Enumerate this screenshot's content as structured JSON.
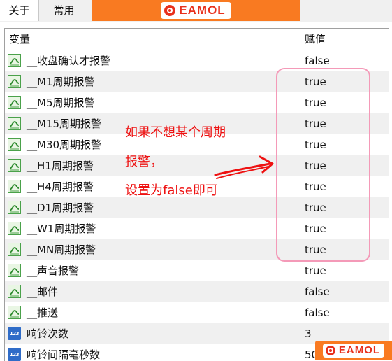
{
  "tabs": [
    {
      "label": "关于"
    },
    {
      "label": "常用"
    }
  ],
  "brand": {
    "name": "EAMOL",
    "color": "#f97a21",
    "logo_color": "#e8301c"
  },
  "grid": {
    "headers": {
      "variable": "变量",
      "value": "赋值"
    },
    "rows": [
      {
        "name": "__收盘确认才报警",
        "value": "false",
        "icon": "bool-icon"
      },
      {
        "name": "__M1周期报警",
        "value": "true",
        "icon": "bool-icon"
      },
      {
        "name": "__M5周期报警",
        "value": "true",
        "icon": "bool-icon"
      },
      {
        "name": "__M15周期报警",
        "value": "true",
        "icon": "bool-icon"
      },
      {
        "name": "__M30周期报警",
        "value": "true",
        "icon": "bool-icon"
      },
      {
        "name": "__H1周期报警",
        "value": "true",
        "icon": "bool-icon"
      },
      {
        "name": "__H4周期报警",
        "value": "true",
        "icon": "bool-icon"
      },
      {
        "name": "__D1周期报警",
        "value": "true",
        "icon": "bool-icon"
      },
      {
        "name": "__W1周期报警",
        "value": "true",
        "icon": "bool-icon"
      },
      {
        "name": "__MN周期报警",
        "value": "true",
        "icon": "bool-icon"
      },
      {
        "name": "__声音报警",
        "value": "true",
        "icon": "bool-icon"
      },
      {
        "name": "__邮件",
        "value": "false",
        "icon": "bool-icon"
      },
      {
        "name": "__推送",
        "value": "false",
        "icon": "bool-icon"
      },
      {
        "name": "响铃次数",
        "value": "3",
        "icon": "number-icon"
      },
      {
        "name": "响铃间隔毫秒数",
        "value": "50",
        "icon": "number-icon"
      }
    ]
  },
  "icons": {
    "number_label": "123"
  },
  "annotation": {
    "lines": [
      "如果不想某个周期",
      "报警，",
      "设置为false即可"
    ],
    "color": "#ee1111",
    "box_color": "#f49ab8"
  }
}
